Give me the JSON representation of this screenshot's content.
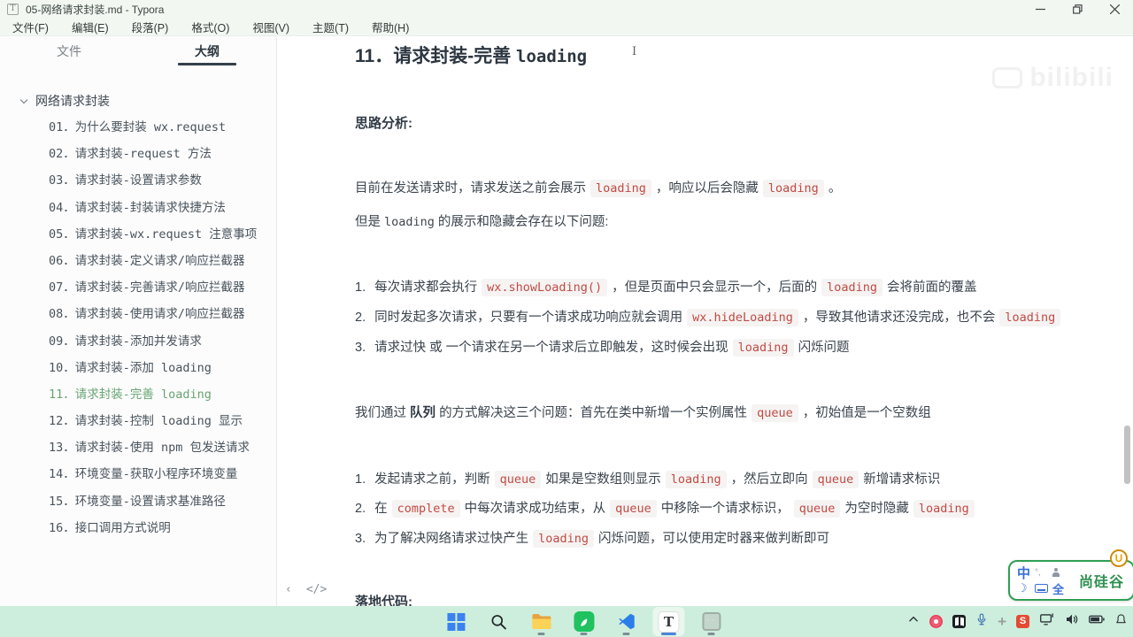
{
  "colors": {
    "code_red": "#c04b43",
    "outline_active_green": "#68a474",
    "taskbar_mint": "#cdeedd",
    "ime_border_green": "#2f9e54",
    "brand_green": "#2e8f4e",
    "brand_orange": "#f0a000",
    "tab_underline": "#343f49"
  },
  "window": {
    "app_icon_letter": "T",
    "title": "05-网络请求封装.md - Typora"
  },
  "menu": {
    "items": [
      "文件(F)",
      "编辑(E)",
      "段落(P)",
      "格式(O)",
      "视图(V)",
      "主题(T)",
      "帮助(H)"
    ]
  },
  "sidebar": {
    "tabs": [
      {
        "label": "文件",
        "active": false
      },
      {
        "label": "大纲",
        "active": true
      }
    ],
    "outline_root": "网络请求封装",
    "outline_items": [
      {
        "label": "01．为什么要封装 wx.request",
        "active": false
      },
      {
        "label": "02．请求封装-request 方法",
        "active": false
      },
      {
        "label": "03．请求封装-设置请求参数",
        "active": false
      },
      {
        "label": "04．请求封装-封装请求快捷方法",
        "active": false
      },
      {
        "label": "05．请求封装-wx.request 注意事项",
        "active": false
      },
      {
        "label": "06．请求封装-定义请求/响应拦截器",
        "active": false
      },
      {
        "label": "07．请求封装-完善请求/响应拦截器",
        "active": false
      },
      {
        "label": "08．请求封装-使用请求/响应拦截器",
        "active": false
      },
      {
        "label": "09．请求封装-添加并发请求",
        "active": false
      },
      {
        "label": "10．请求封装-添加 loading",
        "active": false
      },
      {
        "label": "11．请求封装-完善 loading",
        "active": true
      },
      {
        "label": "12．请求封装-控制 loading 显示",
        "active": false
      },
      {
        "label": "13．请求封装-使用 npm 包发送请求",
        "active": false
      },
      {
        "label": "14．环境变量-获取小程序环境变量",
        "active": false
      },
      {
        "label": "15．环境变量-设置请求基准路径",
        "active": false
      },
      {
        "label": "16．接口调用方式说明",
        "active": false
      }
    ]
  },
  "content": {
    "heading": {
      "prefix": "11．请求封装-完善 ",
      "code": "loading",
      "cursor": "I"
    },
    "analysis_label": "思路分析:",
    "para_intro": [
      {
        "s": "text",
        "v": "目前在发送请求时，请求发送之前会展示"
      },
      {
        "s": "code",
        "v": "loading"
      },
      {
        "s": "text",
        "v": "，响应以后会隐藏"
      },
      {
        "s": "code",
        "v": "loading"
      },
      {
        "s": "text",
        "v": "。"
      }
    ],
    "para_problem_lead": [
      {
        "s": "text",
        "v": "但是"
      },
      {
        "s": "mono",
        "v": "loading"
      },
      {
        "s": "text",
        "v": "的展示和隐藏会存在以下问题:"
      }
    ],
    "problem_list": [
      {
        "num": "1.",
        "segs": [
          {
            "s": "text",
            "v": "每次请求都会执行"
          },
          {
            "s": "code",
            "v": "wx.showLoading()"
          },
          {
            "s": "text",
            "v": "，但是页面中只会显示一个，后面的"
          },
          {
            "s": "code",
            "v": "loading"
          },
          {
            "s": "text",
            "v": "会将前面的覆盖"
          }
        ]
      },
      {
        "num": "2.",
        "segs": [
          {
            "s": "text",
            "v": "同时发起多次请求，只要有一个请求成功响应就会调用"
          },
          {
            "s": "code",
            "v": "wx.hideLoading"
          },
          {
            "s": "text",
            "v": "，导致其他请求还没完成，也不会"
          },
          {
            "s": "code",
            "v": "loading"
          }
        ]
      },
      {
        "num": "3.",
        "segs": [
          {
            "s": "text",
            "v": "请求过快 或 一个请求在另一个请求后立即触发，这时候会出现"
          },
          {
            "s": "code",
            "v": "loading"
          },
          {
            "s": "text",
            "v": "闪烁问题"
          }
        ]
      }
    ],
    "para_solution": [
      {
        "s": "text",
        "v": "我们通过"
      },
      {
        "s": "bold",
        "v": " 队列 "
      },
      {
        "s": "text",
        "v": "的方式解决这三个问题：首先在类中新增一个实例属性"
      },
      {
        "s": "code",
        "v": "queue"
      },
      {
        "s": "text",
        "v": "，初始值是一个空数组"
      }
    ],
    "solution_list": [
      {
        "num": "1.",
        "segs": [
          {
            "s": "text",
            "v": "发起请求之前，判断"
          },
          {
            "s": "code",
            "v": "queue"
          },
          {
            "s": "text",
            "v": "如果是空数组则显示"
          },
          {
            "s": "code",
            "v": "loading"
          },
          {
            "s": "text",
            "v": "，然后立即向"
          },
          {
            "s": "code",
            "v": "queue"
          },
          {
            "s": "text",
            "v": "新增请求标识"
          }
        ]
      },
      {
        "num": "2.",
        "segs": [
          {
            "s": "text",
            "v": "在"
          },
          {
            "s": "code",
            "v": "complete"
          },
          {
            "s": "text",
            "v": "中每次请求成功结束，从"
          },
          {
            "s": "code",
            "v": "queue"
          },
          {
            "s": "text",
            "v": "中移除一个请求标识，"
          },
          {
            "s": "code",
            "v": "queue"
          },
          {
            "s": "text",
            "v": "为空时隐藏"
          },
          {
            "s": "code",
            "v": "loading"
          }
        ]
      },
      {
        "num": "3.",
        "segs": [
          {
            "s": "text",
            "v": "为了解决网络请求过快产生"
          },
          {
            "s": "code",
            "v": "loading"
          },
          {
            "s": "text",
            "v": "闪烁问题，可以使用定时器来做判断即可"
          }
        ]
      }
    ],
    "footer_heading": "落地代码:",
    "statusbar": {
      "collapse_icon": "‹",
      "source_icon": "</>"
    }
  },
  "watermark": {
    "brand": "bilibili"
  },
  "ime": {
    "mode": "中",
    "dots": "°,",
    "full": "全",
    "brand": "尚硅谷",
    "brand_badge": "U"
  },
  "taskbar": {
    "apps": [
      "start",
      "search",
      "file-explorer",
      "wechat-devtools",
      "vscode",
      "typora",
      "background-app"
    ],
    "typora_letter": "T",
    "snipaste_letter": "S",
    "tray": [
      "tray-expand",
      "recorder",
      "capture-app",
      "microphone",
      "utility",
      "snipaste",
      "cast-display",
      "volume",
      "battery",
      "notification-bell"
    ]
  }
}
